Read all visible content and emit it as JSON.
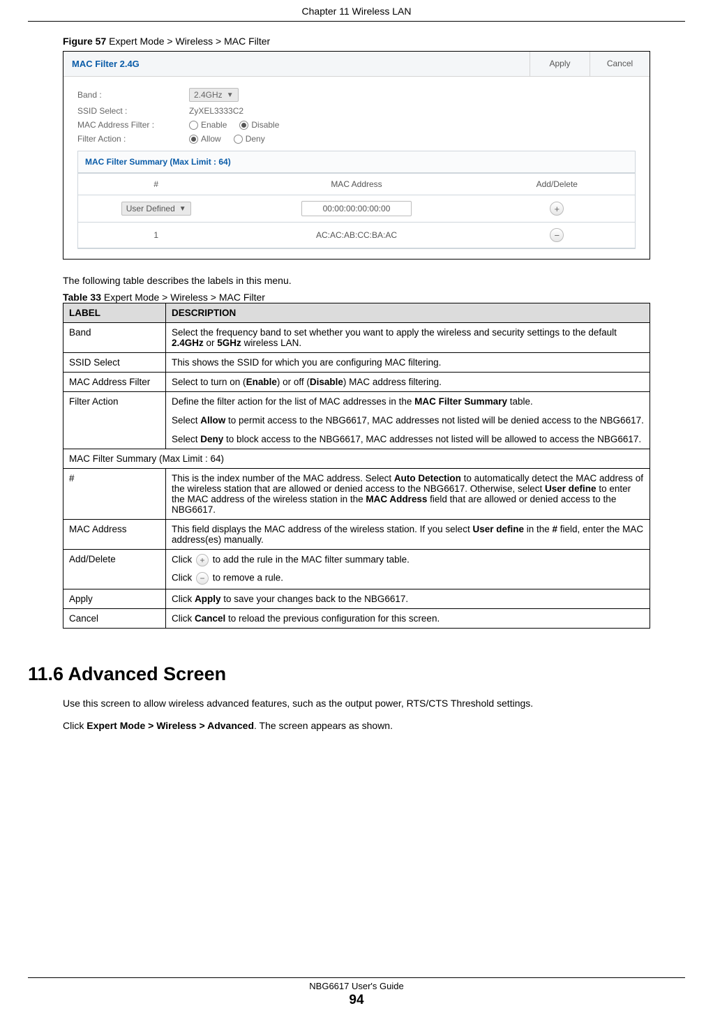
{
  "header_chapter": "Chapter 11 Wireless LAN",
  "figure_label_prefix": "Figure 57",
  "figure_label_text": "   Expert Mode > Wireless > MAC Filter",
  "screenshot": {
    "title": "MAC Filter 2.4G",
    "apply_label": "Apply",
    "cancel_label": "Cancel",
    "rows": {
      "band_label": "Band :",
      "band_value": "2.4GHz",
      "ssid_label": "SSID Select :",
      "ssid_value": "ZyXEL3333C2",
      "macfilter_label": "MAC Address Filter :",
      "macfilter_enable": "Enable",
      "macfilter_disable": "Disable",
      "action_label": "Filter Action :",
      "action_allow": "Allow",
      "action_deny": "Deny"
    },
    "summary_title": "MAC Filter Summary (Max Limit : 64)",
    "cols": {
      "idx": "#",
      "mac": "MAC Address",
      "ad": "Add/Delete"
    },
    "r1_sel": "User Defined",
    "r1_mac": "00:00:00:00:00:00",
    "r2_idx": "1",
    "r2_mac": "AC:AC:AB:CC:BA:AC"
  },
  "intro_text": "The following table describes the labels in this menu.",
  "table_label_prefix": "Table 33",
  "table_label_text": "   Expert Mode > Wireless > MAC Filter",
  "desc_header_label": "LABEL",
  "desc_header_desc": "DESCRIPTION",
  "desc": {
    "band_l": "Band",
    "band_d_pre": "Select the frequency band to set whether you want to apply the wireless and security settings to the default ",
    "band_d_b1": "2.4GHz",
    "band_d_mid": " or ",
    "band_d_b2": "5GHz",
    "band_d_post": " wireless LAN.",
    "ssid_l": "SSID Select",
    "ssid_d": "This shows the SSID for which you are configuring MAC filtering.",
    "maf_l": "MAC Address Filter",
    "maf_d_pre": "Select to turn on (",
    "maf_d_b1": "Enable",
    "maf_d_mid": ") or off (",
    "maf_d_b2": "Disable",
    "maf_d_post": ") MAC address filtering.",
    "fa_l": "Filter Action",
    "fa_p1_pre": "Define the filter action for the list of MAC addresses in the ",
    "fa_p1_b": "MAC Filter Summary",
    "fa_p1_post": " table.",
    "fa_p2_pre": "Select ",
    "fa_p2_b": "Allow",
    "fa_p2_post": " to permit access to the NBG6617, MAC addresses not listed will be denied access to the NBG6617.",
    "fa_p3_pre": "Select ",
    "fa_p3_b": "Deny",
    "fa_p3_post": " to block access to the NBG6617, MAC addresses not listed will be allowed to access the NBG6617.",
    "sum_sub": "MAC Filter Summary (Max Limit : 64)",
    "idx_l": "#",
    "idx_d_pre": "This is the index number of the MAC address. Select ",
    "idx_d_b1": "Auto Detection",
    "idx_d_mid1": " to automatically detect the MAC address of the wireless station that are allowed or denied access to the NBG6617. Otherwise, select ",
    "idx_d_b2": "User define",
    "idx_d_mid2": " to enter the MAC address of the wireless station in the ",
    "idx_d_b3": "MAC Address",
    "idx_d_post": " field that are allowed or denied access to the NBG6617.",
    "mac_l": "MAC Address",
    "mac_d_pre": "This field displays the MAC address of the wireless station. If you select ",
    "mac_d_b1": "User define",
    "mac_d_mid": " in the ",
    "mac_d_b2": "#",
    "mac_d_post": " field, enter the MAC address(es) manually.",
    "ad_l": "Add/Delete",
    "ad_p1_pre": "Click ",
    "ad_p1_post": " to add the rule in the MAC filter summary table.",
    "ad_p2_pre": "Click ",
    "ad_p2_post": "  to remove a rule.",
    "apply_l": "Apply",
    "apply_d_pre": "Click ",
    "apply_d_b": "Apply",
    "apply_d_post": " to save your changes back to the NBG6617.",
    "cancel_l": "Cancel",
    "cancel_d_pre": "Click ",
    "cancel_d_b": "Cancel",
    "cancel_d_post": " to reload the previous configuration for this screen."
  },
  "section_heading": "11.6  Advanced Screen",
  "section_p1": "Use this screen to allow wireless advanced features, such as the output power, RTS/CTS Threshold settings.",
  "section_p2_pre": "Click ",
  "section_p2_b": "Expert Mode > Wireless > Advanced",
  "section_p2_post": ". The screen appears as shown.",
  "footer_text": "NBG6617 User's Guide",
  "footer_page": "94"
}
